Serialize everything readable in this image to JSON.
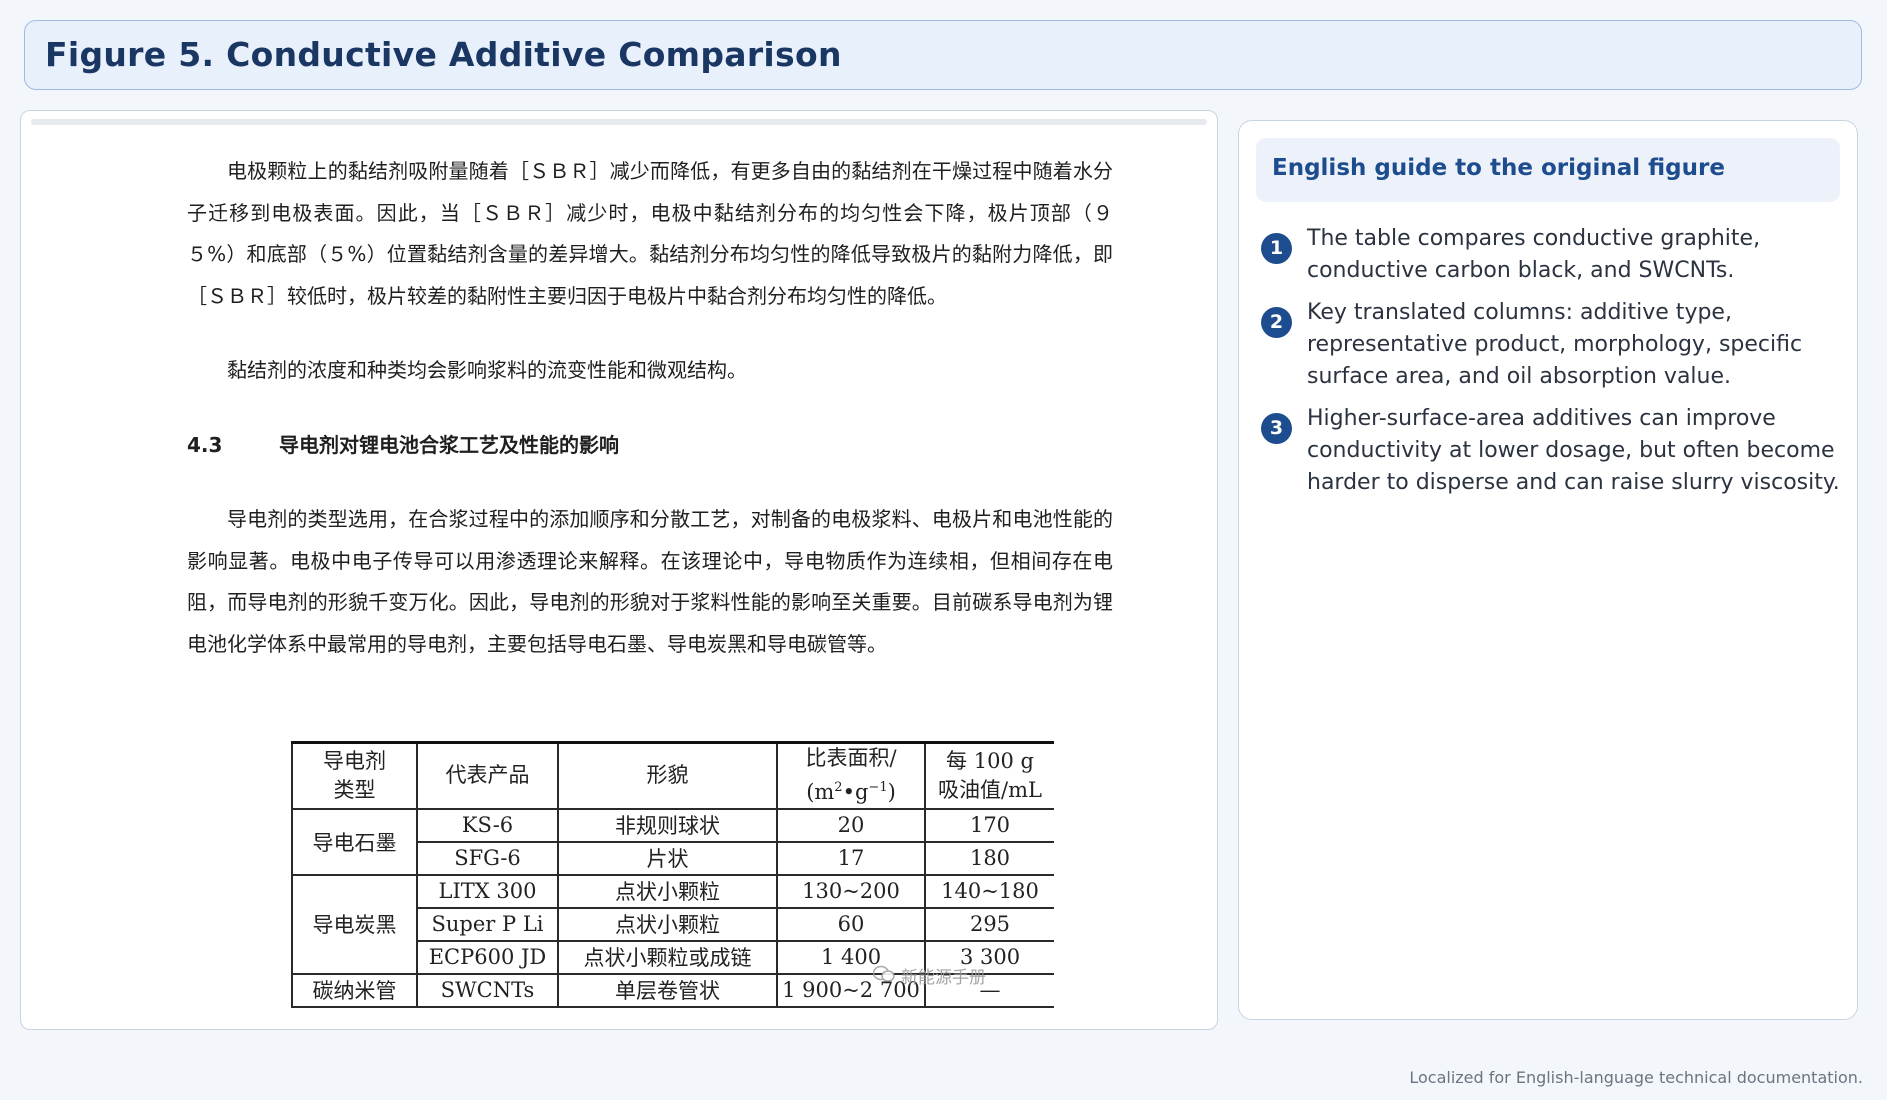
{
  "title": "Figure 5. Conductive Additive Comparison",
  "document": {
    "paragraphs": [
      "电极颗粒上的黏结剂吸附量随着［ＳＢＲ］减少而降低，有更多自由的黏结剂在干燥过程中随着水分子迁移到电极表面。因此，当［ＳＢＲ］减少时，电极中黏结剂分布的均匀性会下降，极片顶部（９５%）和底部（５%）位置黏结剂含量的差异增大。黏结剂分布均匀性的降低导致极片的黏附力降低，即［ＳＢＲ］较低时，极片较差的黏附性主要归因于电极片中黏合剂分布均匀性的降低。",
      "黏结剂的浓度和种类均会影响浆料的流变性能和微观结构。"
    ],
    "section": {
      "number": "4.3",
      "title": "导电剂对锂电池合浆工艺及性能的影响"
    },
    "paragraph3": "导电剂的类型选用，在合浆过程中的添加顺序和分散工艺，对制备的电极浆料、电极片和电池性能的影响显著。电极中电子传导可以用渗透理论来解释。在该理论中，导电物质作为连续相，但相间存在电阻，而导电剂的形貌千变万化。因此，导电剂的形貌对于浆料性能的影响至关重要。目前碳系导电剂为锂电池化学体系中最常用的导电剂，主要包括导电石墨、导电炭黑和导电碳管等。"
  },
  "table": {
    "headers": {
      "type_l1": "导电剂",
      "type_l2": "类型",
      "product": "代表产品",
      "morph": "形貌",
      "area_l1": "比表面积/",
      "area_l2_pre": "(m",
      "area_sup1": "2",
      "area_mid": "•g",
      "area_sup2": "−1",
      "area_post": ")",
      "oil_l1": "每 100 g",
      "oil_l2": "吸油值/mL"
    },
    "groups": {
      "graphite": "导电石墨",
      "carbon_black": "导电炭黑",
      "cnt": "碳纳米管"
    },
    "rows": [
      {
        "product": "KS-6",
        "morph": "非规则球状",
        "area": "20",
        "oil": "170"
      },
      {
        "product": "SFG-6",
        "morph": "片状",
        "area": "17",
        "oil": "180"
      },
      {
        "product": "LITX 300",
        "morph": "点状小颗粒",
        "area": "130~200",
        "oil": "140~180"
      },
      {
        "product": "Super P Li",
        "morph": "点状小颗粒",
        "area": "60",
        "oil": "295"
      },
      {
        "product": "ECP600 JD",
        "morph": "点状小颗粒或成链",
        "area": "1 400",
        "oil": "3 300"
      },
      {
        "product": "SWCNTs",
        "morph": "单层卷管状",
        "area": "1 900~2 700",
        "oil": "—"
      }
    ],
    "watermark": "新能源手册"
  },
  "guide": {
    "heading": "English guide to the original figure",
    "items": [
      {
        "num": "1",
        "text": "The table compares conductive graphite, conductive carbon black, and SWCNTs."
      },
      {
        "num": "2",
        "text": "Key translated columns: additive type, representative product, morphology, specific surface area, and oil absorption value."
      },
      {
        "num": "3",
        "text": "Higher-surface-area additives can improve conductivity at lower dosage, but often become harder to disperse and can raise slurry viscosity."
      }
    ]
  },
  "footer": "Localized for English-language technical documentation."
}
